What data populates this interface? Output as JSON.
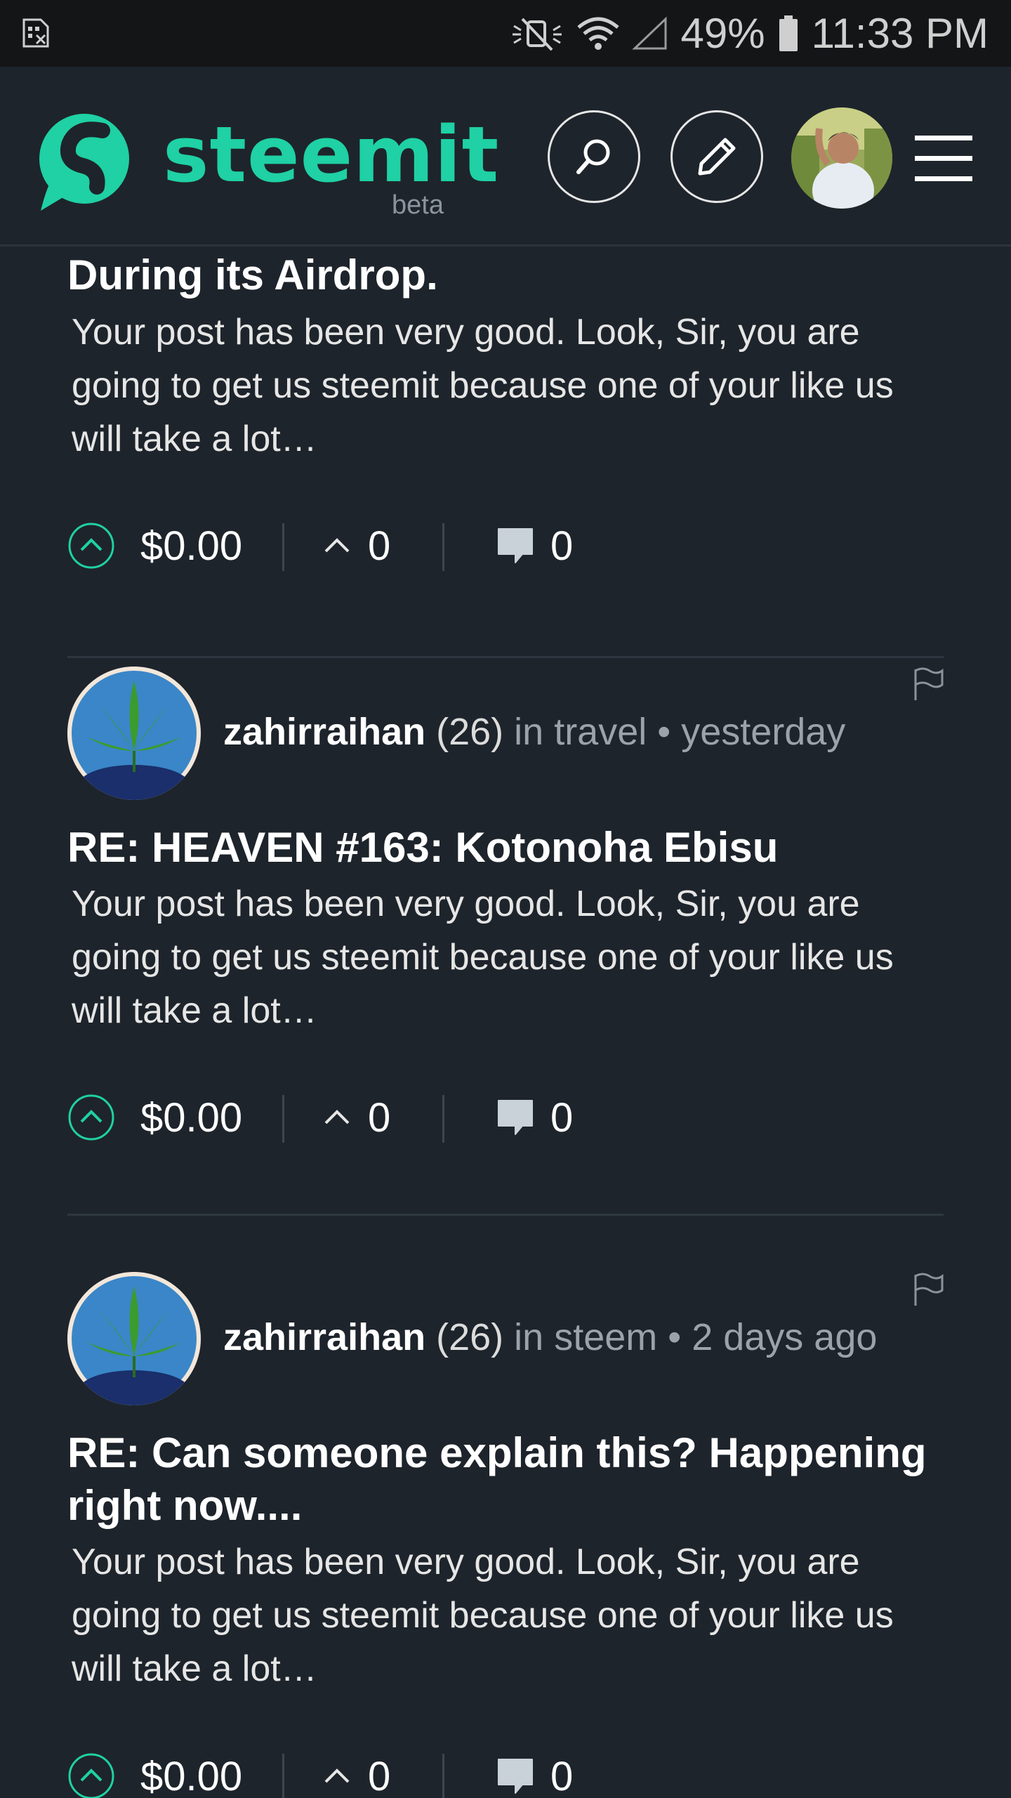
{
  "status_bar": {
    "battery": "49%",
    "time": "11:33 PM"
  },
  "header": {
    "logo_text": "steemit",
    "logo_badge": "beta"
  },
  "colors": {
    "accent": "#1fd1a4",
    "background": "#1e242b",
    "statusbar": "#131517"
  },
  "posts": [
    {
      "title": "During its Airdrop.",
      "excerpt": "Your post has been very good. Look, Sir, you are going to get us steemit because one of your like us will take a lot…",
      "payout": "$0.00",
      "votes": "0",
      "comments": "0"
    },
    {
      "author": "zahirraihan",
      "reputation": "(26)",
      "category": "in travel",
      "separator": "•",
      "time": "yesterday",
      "title": "RE: HEAVEN #163: Kotonoha Ebisu",
      "excerpt": "Your post has been very good. Look, Sir, you are going to get us steemit because one of your like us will take a lot…",
      "payout": "$0.00",
      "votes": "0",
      "comments": "0"
    },
    {
      "author": "zahirraihan",
      "reputation": "(26)",
      "category": "in steem",
      "separator": "•",
      "time": "2 days ago",
      "title": "RE: Can someone explain this? Happening right now....",
      "excerpt": "Your post has been very good. Look, Sir, you are going to get us steemit because one of your like us will take a lot…",
      "payout": "$0.00",
      "votes": "0",
      "comments": "0"
    }
  ],
  "icons": [
    "sim-icon",
    "mute-icon",
    "wifi-icon",
    "signal-icon",
    "battery-icon",
    "steemit-logo-icon",
    "search-icon",
    "pencil-icon",
    "menu-icon",
    "flag-icon",
    "upvote-icon",
    "chevron-up-icon",
    "comment-icon"
  ]
}
